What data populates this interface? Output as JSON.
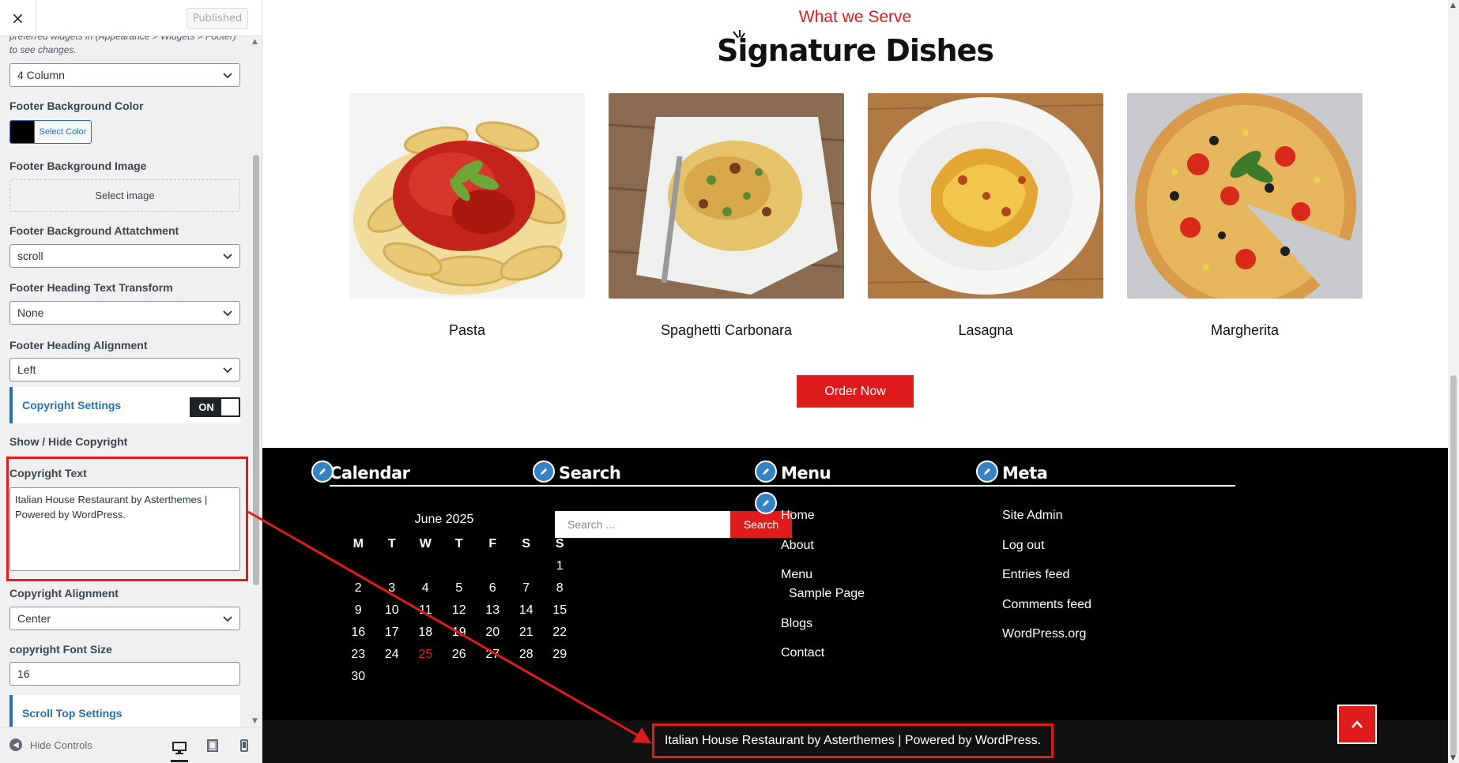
{
  "customizer": {
    "close_label": "×",
    "published_label": "Published",
    "footer_widgets_desc": "preferred widgets in (Appearance > Widgets > Footer) to see changes.",
    "footer_columns_value": "4 Column",
    "bg_color_label": "Footer Background Color",
    "select_color_label": "Select Color",
    "bg_image_label": "Footer Background Image",
    "select_image_label": "Select image",
    "bg_attachment_label": "Footer Background Attatchment",
    "bg_attachment_value": "scroll",
    "heading_transform_label": "Footer Heading Text Transform",
    "heading_transform_value": "None",
    "heading_alignment_label": "Footer Heading Alignment",
    "heading_alignment_value": "Left",
    "copyright_section_label": "Copyright Settings",
    "show_copyright_label": "Show / Hide Copyright",
    "toggle_on_label": "ON",
    "copyright_text_label": "Copyright Text",
    "copyright_text_value": "Italian House Restaurant by Asterthemes | Powered by WordPress.",
    "copyright_alignment_label": "Copyright Alignment",
    "copyright_alignment_value": "Center",
    "font_size_label": "copyright Font Size",
    "font_size_value": "16",
    "scroll_top_section_label": "Scroll Top Settings",
    "hide_controls_label": "Hide Controls"
  },
  "preview": {
    "eyebrow": "What we Serve",
    "heading": "Signature Dishes",
    "dishes": [
      {
        "name": "Pasta"
      },
      {
        "name": "Spaghetti Carbonara"
      },
      {
        "name": "Lasagna"
      },
      {
        "name": "Margherita"
      }
    ],
    "order_button": "Order Now",
    "footer": {
      "calendar_title": "Calendar",
      "calendar_caption": "June 2025",
      "weekdays": [
        "M",
        "T",
        "W",
        "T",
        "F",
        "S",
        "S"
      ],
      "weeks": [
        [
          "",
          "",
          "",
          "",
          "",
          "",
          "1"
        ],
        [
          "2",
          "3",
          "4",
          "5",
          "6",
          "7",
          "8"
        ],
        [
          "9",
          "10",
          "11",
          "12",
          "13",
          "14",
          "15"
        ],
        [
          "16",
          "17",
          "18",
          "19",
          "20",
          "21",
          "22"
        ],
        [
          "23",
          "24",
          "25",
          "26",
          "27",
          "28",
          "29"
        ],
        [
          "30",
          "",
          "",
          "",
          "",
          "",
          ""
        ]
      ],
      "today": "25",
      "search_title": "Search",
      "search_placeholder": "Search ...",
      "search_button": "Search",
      "menu_title": "Menu",
      "menu_items": [
        "Home",
        "About",
        "Menu",
        "Sample Page",
        "Blogs",
        "Contact"
      ],
      "meta_title": "Meta",
      "meta_items": [
        "Site Admin",
        "Log out",
        "Entries feed",
        "Comments feed",
        "WordPress.org"
      ]
    },
    "copyright": "Italian House Restaurant by Asterthemes | Powered by WordPress."
  },
  "colors": {
    "accent_red": "#e01b1b",
    "wp_blue": "#2271b1",
    "footer_bg": "#000000"
  }
}
